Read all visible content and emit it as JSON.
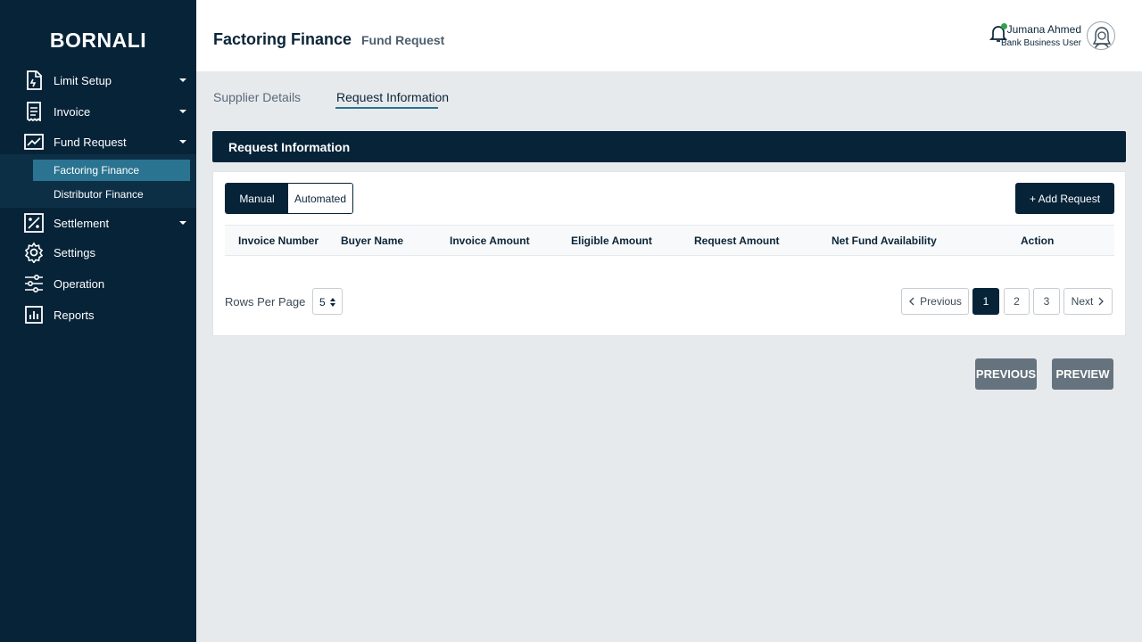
{
  "brand": "BORNALI",
  "sidebar": {
    "items": [
      {
        "label": "Limit Setup",
        "icon": "document-icon"
      },
      {
        "label": "Invoice",
        "icon": "receipt-icon"
      },
      {
        "label": "Fund Request",
        "icon": "chart-icon"
      },
      {
        "label": "Settlement",
        "icon": "percent-icon"
      },
      {
        "label": "Settings",
        "icon": "gear-icon"
      },
      {
        "label": "Operation",
        "icon": "sliders-icon"
      },
      {
        "label": "Reports",
        "icon": "bar-chart-icon"
      }
    ],
    "sub_items": [
      {
        "label": "Factoring Finance",
        "active": true
      },
      {
        "label": "Distributor Finance",
        "active": false
      }
    ]
  },
  "header": {
    "title": "Factoring Finance",
    "subtitle": "Fund Request",
    "user_name": "Jumana Ahmed",
    "user_role": "Bank Business User",
    "notification_status_color": "#2fa34a"
  },
  "tabs": [
    {
      "label": "Supplier Details",
      "active": false
    },
    {
      "label": "Request Information",
      "active": true
    }
  ],
  "section": {
    "title": "Request Information",
    "toggle": [
      "Manual",
      "Automated"
    ],
    "toggle_selected": "Manual",
    "add_button": "+ Add Request",
    "columns": [
      "Invoice Number",
      "Buyer Name",
      "Invoice Amount",
      "Eligible Amount",
      "Request Amount",
      "Net Fund Availability",
      "Action"
    ],
    "rows": []
  },
  "pagination": {
    "rows_per_page_label": "Rows Per Page",
    "rows_per_page": "5",
    "previous": "Previous",
    "pages": [
      "1",
      "2",
      "3"
    ],
    "current_page": "1",
    "next": "Next"
  },
  "footer_buttons": {
    "previous": "PREVIOUS",
    "preview": "PREVIEW"
  },
  "colors": {
    "sidebar_bg": "#062338",
    "accent": "#2a7391",
    "button_disabled": "#65737e"
  }
}
